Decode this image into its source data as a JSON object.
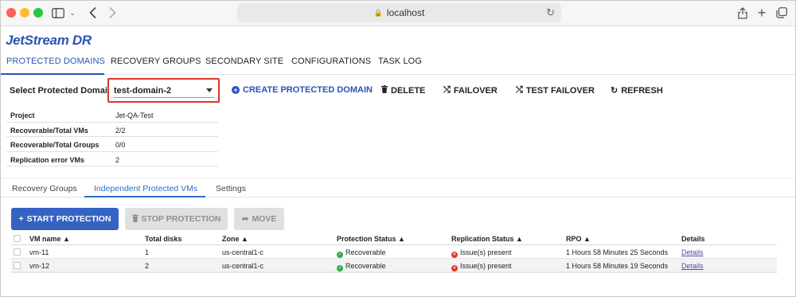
{
  "browser": {
    "url": "localhost"
  },
  "app": {
    "logo": "JetStream DR"
  },
  "main_tabs": [
    {
      "label": "PROTECTED DOMAINS",
      "active": true
    },
    {
      "label": "RECOVERY GROUPS",
      "active": false
    },
    {
      "label": "SECONDARY SITE",
      "active": false
    },
    {
      "label": "CONFIGURATIONS",
      "active": false
    },
    {
      "label": "TASK LOG",
      "active": false
    }
  ],
  "toolbar": {
    "select_label": "Select Protected Domain:",
    "selected_domain": "test-domain-2",
    "create_label": "CREATE PROTECTED DOMAIN",
    "delete_label": "DELETE",
    "failover_label": "FAILOVER",
    "test_failover_label": "TEST FAILOVER",
    "refresh_label": "REFRESH"
  },
  "info": [
    {
      "key": "Project",
      "value": "Jet-QA-Test"
    },
    {
      "key": "Recoverable/Total VMs",
      "value": "2/2"
    },
    {
      "key": "Recoverable/Total Groups",
      "value": "0/0"
    },
    {
      "key": "Replication error VMs",
      "value": "2"
    }
  ],
  "sub_tabs": [
    {
      "label": "Recovery Groups",
      "active": false
    },
    {
      "label": "Independent Protected VMs",
      "active": true
    },
    {
      "label": "Settings",
      "active": false
    }
  ],
  "actions": {
    "start_label": "START PROTECTION",
    "stop_label": "STOP PROTECTION",
    "move_label": "MOVE"
  },
  "grid": {
    "columns": [
      "VM name ▲",
      "Total disks",
      "Zone ▲",
      "Protection Status ▲",
      "Replication Status ▲",
      "RPO ▲",
      "Details"
    ],
    "rows": [
      {
        "vm_name": "vm-11",
        "total_disks": "1",
        "zone": "us-central1-c",
        "protection_status": "Recoverable",
        "replication_status": "Issue(s) present",
        "rpo": "1 Hours 58 Minutes 25 Seconds",
        "details": "Details"
      },
      {
        "vm_name": "vm-12",
        "total_disks": "2",
        "zone": "us-central1-c",
        "protection_status": "Recoverable",
        "replication_status": "Issue(s) present",
        "rpo": "1 Hours 58 Minutes 19 Seconds",
        "details": "Details"
      }
    ]
  },
  "colors": {
    "brand_blue": "#2c53b4",
    "primary_button": "#3463c4",
    "highlight_border": "#d9382c",
    "ok_green": "#2fa84f",
    "error_red": "#d93a2b"
  }
}
